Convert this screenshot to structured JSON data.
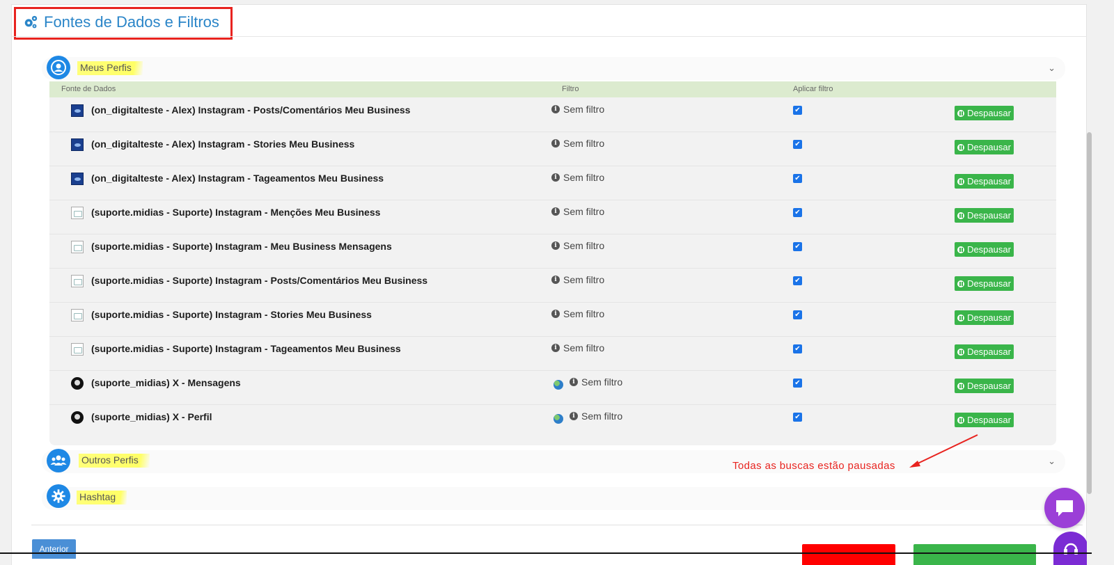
{
  "section": {
    "title": "Fontes de Dados e Filtros",
    "icon": "gears-icon"
  },
  "accordions": {
    "meus_perfis": {
      "label": "Meus Perfis",
      "icon": "user-circle-icon",
      "expanded": true
    },
    "outros_perfis": {
      "label": "Outros Perfis",
      "icon": "users-icon",
      "expanded": false
    },
    "hashtag": {
      "label": "Hashtag",
      "icon": "gear-icon",
      "expanded": false
    }
  },
  "table": {
    "headers": {
      "source": "Fonte de Dados",
      "filter": "Filtro",
      "apply": "Aplicar filtro"
    },
    "rows": [
      {
        "source": "(on_digitalteste - Alex)  Instagram - Posts/Comentários Meu Business",
        "avatar": "instagram-avatar",
        "filter": "Sem filtro",
        "globe": false,
        "checked": true,
        "action": "Despausar"
      },
      {
        "source": "(on_digitalteste - Alex)  Instagram - Stories Meu Business",
        "avatar": "instagram-avatar",
        "filter": "Sem filtro",
        "globe": false,
        "checked": true,
        "action": "Despausar"
      },
      {
        "source": "(on_digitalteste - Alex)  Instagram - Tageamentos Meu Business",
        "avatar": "instagram-avatar",
        "filter": "Sem filtro",
        "globe": false,
        "checked": true,
        "action": "Despausar"
      },
      {
        "source": "(suporte.midias - Suporte)  Instagram - Menções Meu Business",
        "avatar": "broken-image",
        "filter": "Sem filtro",
        "globe": false,
        "checked": true,
        "action": "Despausar"
      },
      {
        "source": "(suporte.midias - Suporte)  Instagram - Meu Business Mensagens",
        "avatar": "broken-image",
        "filter": "Sem filtro",
        "globe": false,
        "checked": true,
        "action": "Despausar"
      },
      {
        "source": "(suporte.midias - Suporte)  Instagram - Posts/Comentários Meu Business",
        "avatar": "broken-image",
        "filter": "Sem filtro",
        "globe": false,
        "checked": true,
        "action": "Despausar"
      },
      {
        "source": "(suporte.midias - Suporte)  Instagram - Stories Meu Business",
        "avatar": "broken-image",
        "filter": "Sem filtro",
        "globe": false,
        "checked": true,
        "action": "Despausar"
      },
      {
        "source": "(suporte.midias - Suporte)  Instagram - Tageamentos Meu Business",
        "avatar": "broken-image",
        "filter": "Sem filtro",
        "globe": false,
        "checked": true,
        "action": "Despausar"
      },
      {
        "source": "(suporte_midias)  X - Mensagens",
        "avatar": "x-avatar",
        "filter": "Sem filtro",
        "globe": true,
        "checked": true,
        "action": "Despausar"
      },
      {
        "source": "(suporte_midias)  X - Perfil",
        "avatar": "x-avatar",
        "filter": "Sem filtro",
        "globe": true,
        "checked": true,
        "action": "Despausar"
      }
    ]
  },
  "annotation": {
    "text": "Todas as buscas estão pausadas",
    "color": "#e8231f"
  },
  "footer": {
    "prev_label": "Anterior",
    "red_button_label": "",
    "green_button_label": ""
  },
  "colors": {
    "accent": "#2a85c8",
    "success": "#3ab54a",
    "header_bg": "#dcebcf",
    "highlight": "#ffff66"
  }
}
